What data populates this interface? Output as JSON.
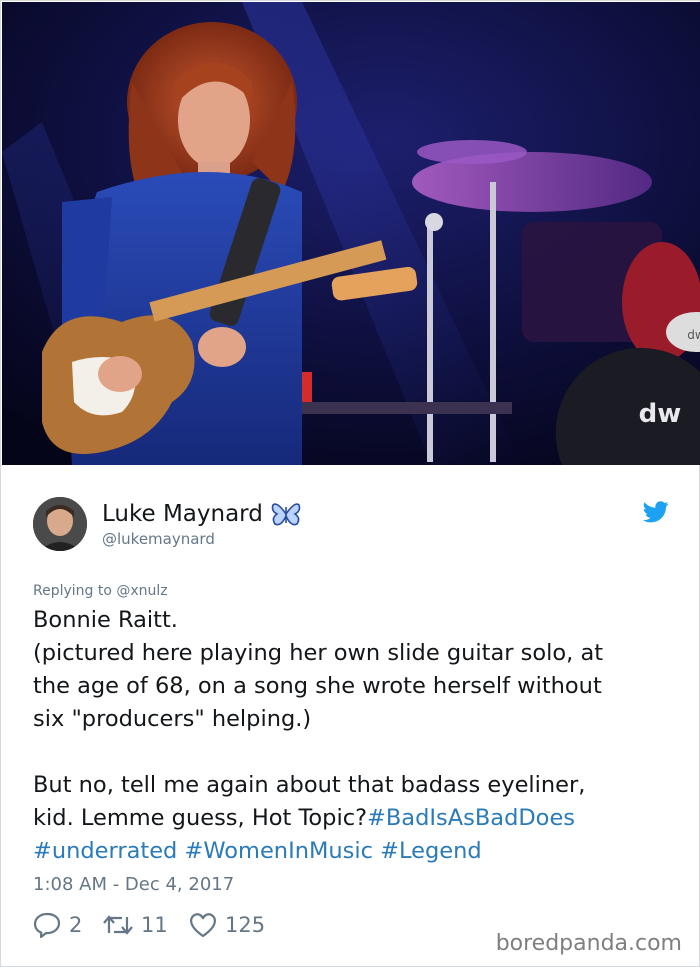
{
  "tweet": {
    "display_name": "Luke Maynard",
    "handle": "@lukemaynard",
    "replying_to": "Replying to @xnulz",
    "body": {
      "line1": "Bonnie Raitt.",
      "line2": "(pictured here playing her own slide guitar solo, at",
      "line3": "the age of 68, on a song she wrote herself without",
      "line4": "six \"producers\" helping.)",
      "line5": "But no, tell me again about that badass eyeliner,",
      "line6_text": "kid. Lemme guess, Hot Topic?",
      "hashtags": [
        "#BadIsAsBadDoes",
        "#underrated",
        "#WomenInMusic",
        "#Legend"
      ]
    },
    "timestamp": "1:08 AM - Dec 4, 2017",
    "counts": {
      "replies": "2",
      "retweets": "11",
      "likes": "125"
    }
  },
  "photo": {
    "drum_logo": "dw"
  },
  "watermark": "boredpanda.com",
  "colors": {
    "link": "#2b7bb9",
    "muted": "#657786",
    "twitter_blue": "#1da1f2",
    "text": "#14171a"
  },
  "icons": {
    "name_badge": "butterfly-icon",
    "platform": "twitter-bird-icon",
    "reply": "reply-icon",
    "retweet": "retweet-icon",
    "like": "heart-icon"
  }
}
